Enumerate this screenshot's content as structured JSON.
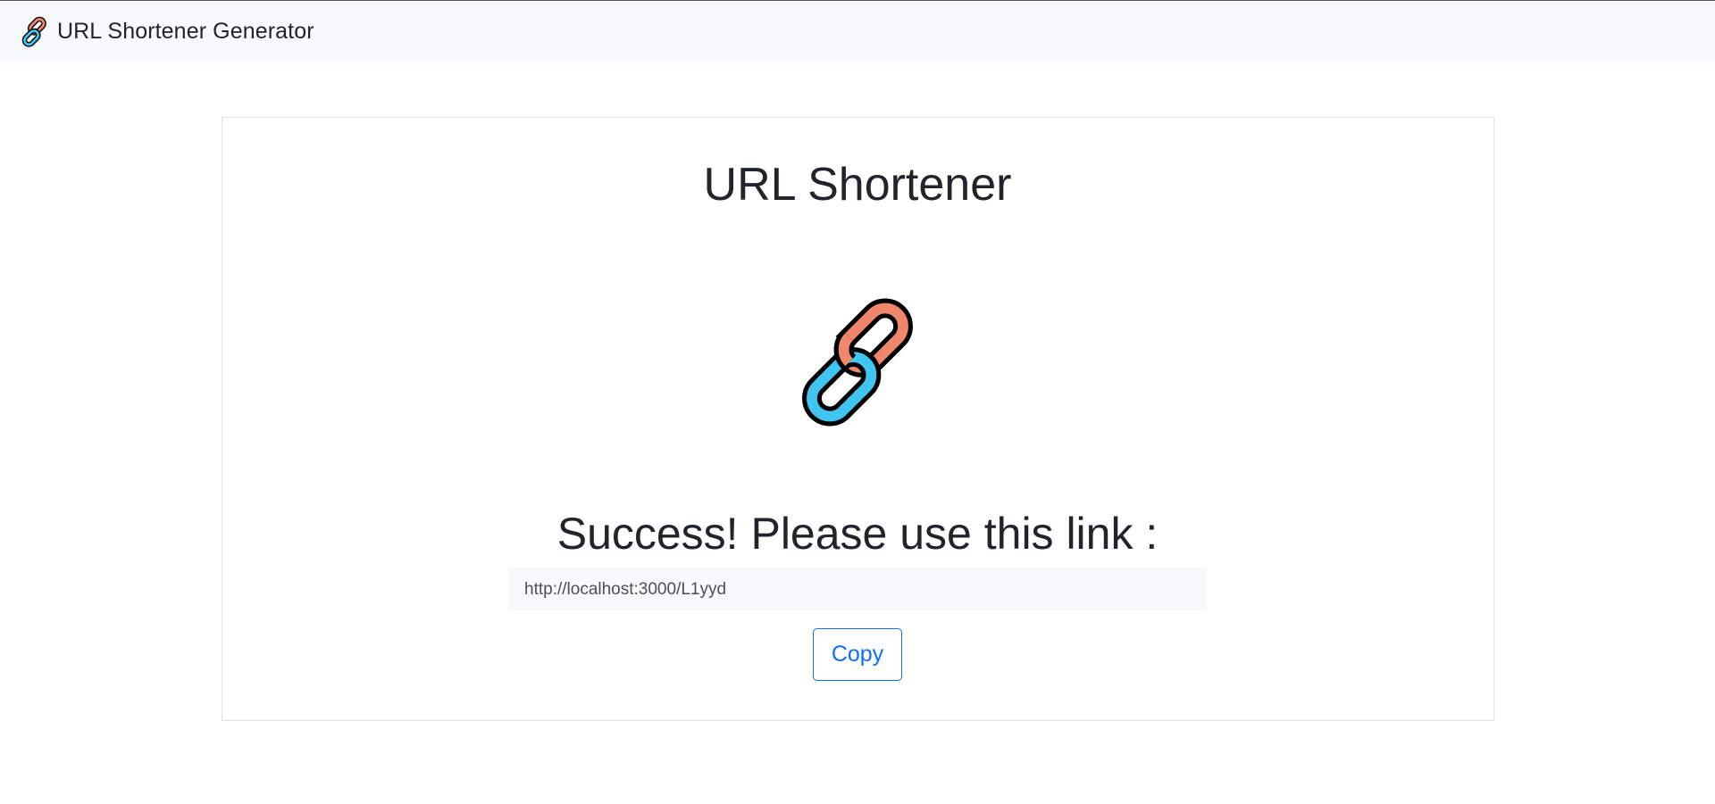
{
  "navbar": {
    "brand_icon": "chain-link-icon",
    "brand_text": "URL Shortener Generator"
  },
  "main": {
    "title": "URL Shortener",
    "logo_icon": "chain-link-icon",
    "success_message": "Success! Please use this link :",
    "short_link": "http://localhost:3000/L1yyd",
    "copy_label": "Copy"
  },
  "colors": {
    "navbar_bg": "#f8f9fa",
    "link_orange": "#f0866a",
    "link_blue": "#3fc5ef",
    "button_blue": "#0d6efd",
    "text_dark": "#212529"
  }
}
